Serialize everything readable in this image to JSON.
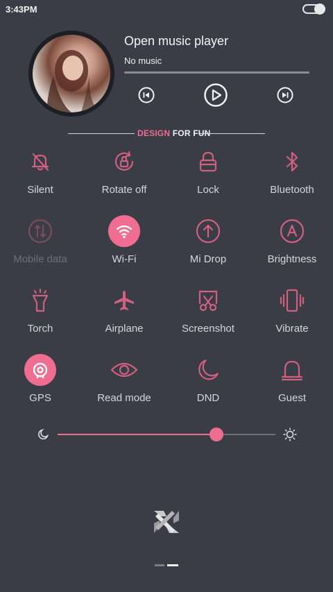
{
  "status": {
    "time": "3:43PM"
  },
  "music": {
    "title": "Open music player",
    "subtitle": "No music",
    "progress": 0
  },
  "banner": {
    "part1": "DESIGN",
    "part2": " FOR FUN"
  },
  "toggles": [
    {
      "label": "Silent",
      "icon": "bell-off-icon",
      "state": "off"
    },
    {
      "label": "Rotate off",
      "icon": "rotate-lock-icon",
      "state": "off"
    },
    {
      "label": "Lock",
      "icon": "lock-icon",
      "state": "off"
    },
    {
      "label": "Bluetooth",
      "icon": "bluetooth-icon",
      "state": "off"
    },
    {
      "label": "Mobile data",
      "icon": "mobile-data-icon",
      "state": "disabled"
    },
    {
      "label": "Wi-Fi",
      "icon": "wifi-icon",
      "state": "on"
    },
    {
      "label": "Mi Drop",
      "icon": "upload-arrow-icon",
      "state": "off"
    },
    {
      "label": "Brightness",
      "icon": "brightness-auto-icon",
      "state": "off"
    },
    {
      "label": "Torch",
      "icon": "torch-icon",
      "state": "off"
    },
    {
      "label": "Airplane",
      "icon": "airplane-icon",
      "state": "off"
    },
    {
      "label": "Screenshot",
      "icon": "scissors-icon",
      "state": "off"
    },
    {
      "label": "Vibrate",
      "icon": "vibrate-icon",
      "state": "off"
    },
    {
      "label": "GPS",
      "icon": "gps-icon",
      "state": "on"
    },
    {
      "label": "Read mode",
      "icon": "eye-icon",
      "state": "off"
    },
    {
      "label": "DND",
      "icon": "moon-icon",
      "state": "off"
    },
    {
      "label": "Guest",
      "icon": "guest-icon",
      "state": "off"
    }
  ],
  "brightness": {
    "level": 0.73
  },
  "colors": {
    "accent": "#ef6d8f",
    "background": "#3a3d45",
    "text": "#d6d6da",
    "dim": "#6c6f77"
  },
  "pager": {
    "current": 2,
    "total": 2
  }
}
